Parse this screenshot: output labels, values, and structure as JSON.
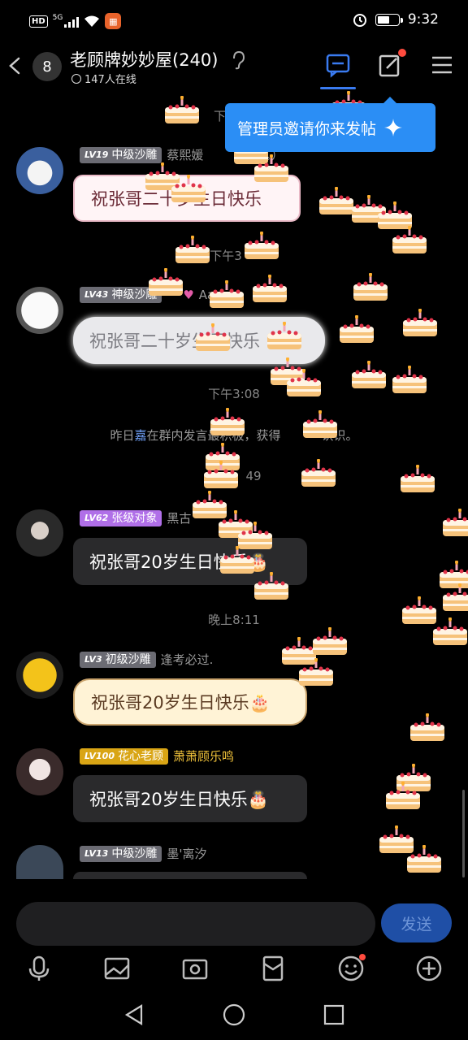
{
  "status_bar": {
    "hd": "HD",
    "net": "5G",
    "time": "9:32"
  },
  "header": {
    "unread_count": "8",
    "title": "老顾牌妙妙屋(240)",
    "online": "147人在线"
  },
  "tooltip": {
    "text": "管理员邀请你来发帖"
  },
  "times": {
    "t0": "下午",
    "t1": "下午3",
    "t2": "下午3:08",
    "t3": "49",
    "t4": "晚上8:11"
  },
  "system_message": {
    "prefix": "昨日",
    "name": "嘉",
    "text": "在群内发言最积极，获得",
    "suffix": "认识。"
  },
  "messages": [
    {
      "level": "LV19",
      "badge": "中级沙雕",
      "name": "蔡熙媛",
      "extra": "。）",
      "text": "祝张哥二十岁生日快乐"
    },
    {
      "level": "LV43",
      "badge": "神级沙雕",
      "name": "Aa",
      "text": "祝张哥二十岁生日快乐"
    },
    {
      "level": "LV62",
      "badge": "张级对象",
      "name": "黑古",
      "text": "祝张哥20岁生日快乐🎂"
    },
    {
      "level": "LV3",
      "badge": "初级沙雕",
      "name": "逢考必过.",
      "text": "祝张哥20岁生日快乐🎂"
    },
    {
      "level": "LV100",
      "badge": "花心老顾",
      "name": "萧萧顾乐鸣",
      "text": "祝张哥20岁生日快乐🎂"
    },
    {
      "level": "LV13",
      "badge": "中级沙雕",
      "name": "墨'离汐",
      "text": ""
    }
  ],
  "input": {
    "send_label": "发送"
  },
  "colors": {
    "accent": "#2b8ef5",
    "badge_gray": "#6b6b73",
    "badge_purple": "#b06fe8",
    "badge_gold": "#d9a515"
  }
}
